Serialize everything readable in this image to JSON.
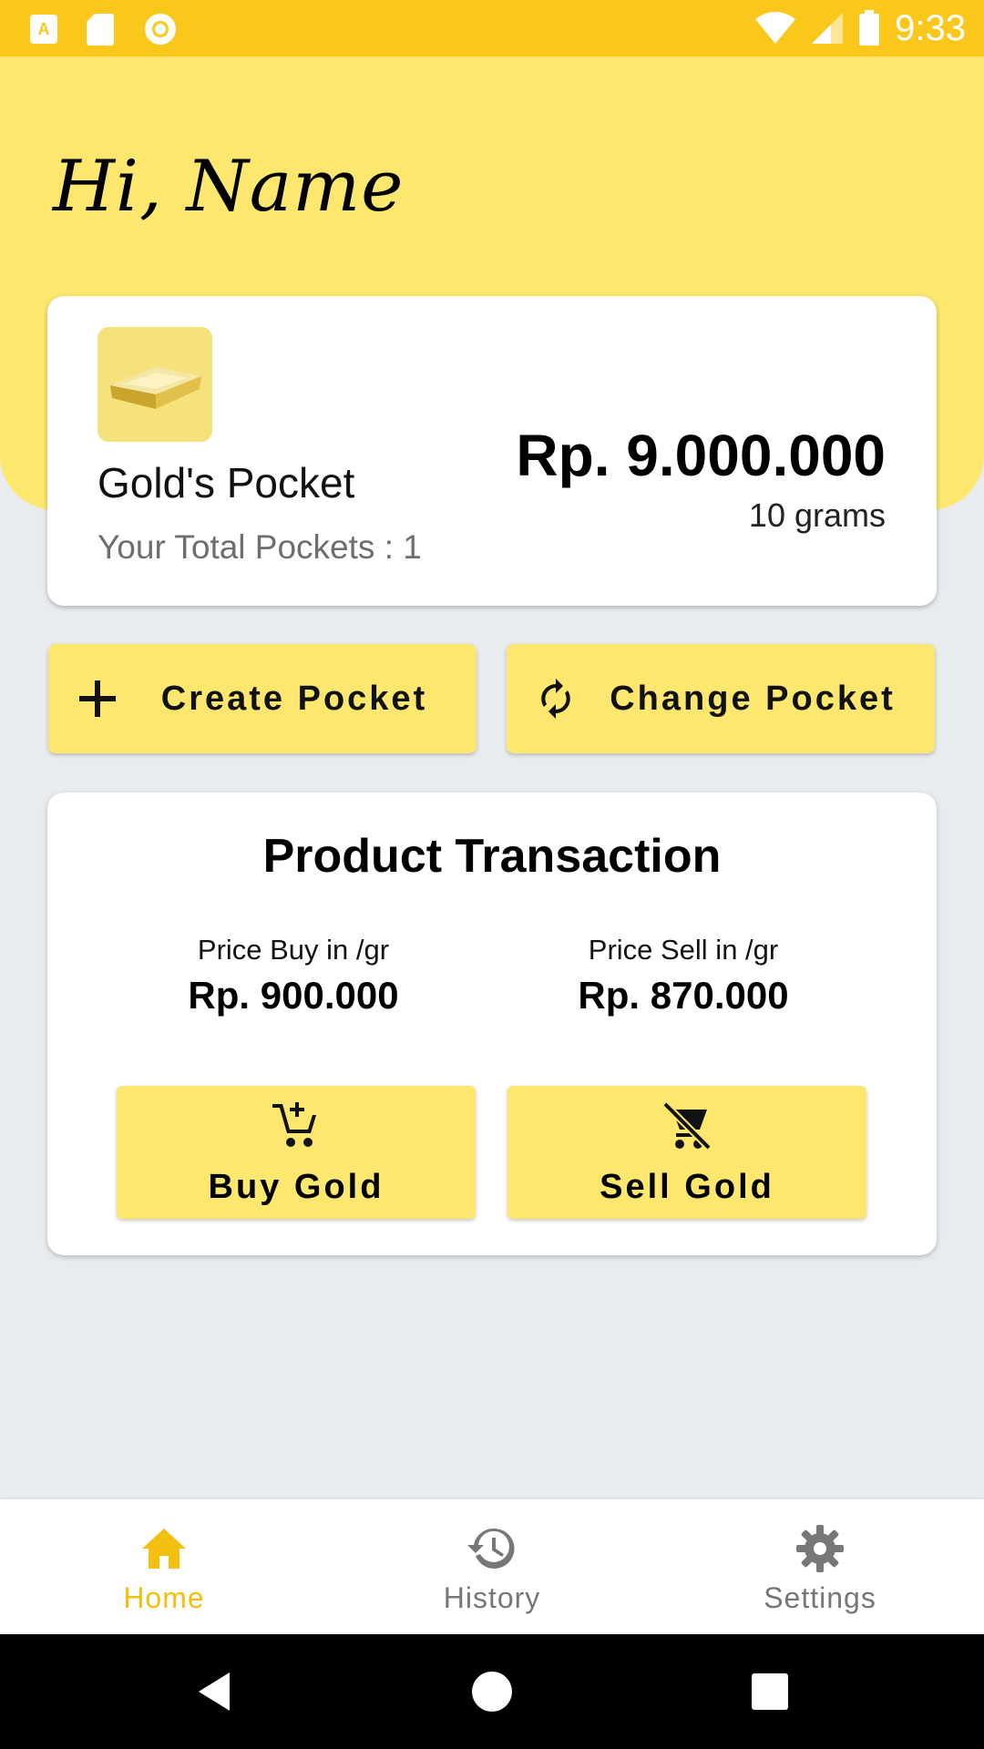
{
  "status_bar": {
    "time": "9:33"
  },
  "header": {
    "greeting": "Hi, Name"
  },
  "pocket": {
    "name": "Gold's Pocket",
    "total_pockets": "Your Total Pockets : 1",
    "amount": "Rp. 9.000.000",
    "weight": "10 grams"
  },
  "actions": {
    "create_label": "Create Pocket",
    "change_label": "Change Pocket"
  },
  "product": {
    "title": "Product Transaction",
    "buy_price_label": "Price Buy in /gr",
    "buy_price_value": "Rp. 900.000",
    "sell_price_label": "Price Sell in /gr",
    "sell_price_value": "Rp. 870.000",
    "buy_button": "Buy Gold",
    "sell_button": "Sell Gold"
  },
  "bottom_nav": {
    "items": [
      {
        "label": "Home",
        "icon": "home-icon",
        "active": true
      },
      {
        "label": "History",
        "icon": "history-icon",
        "active": false
      },
      {
        "label": "Settings",
        "icon": "settings-icon",
        "active": false
      }
    ]
  },
  "colors": {
    "status_bar": "#fbc71a",
    "header": "#fde76f",
    "button": "#fde76f",
    "active_nav": "#f5bf12",
    "background": "#e9ecef"
  }
}
